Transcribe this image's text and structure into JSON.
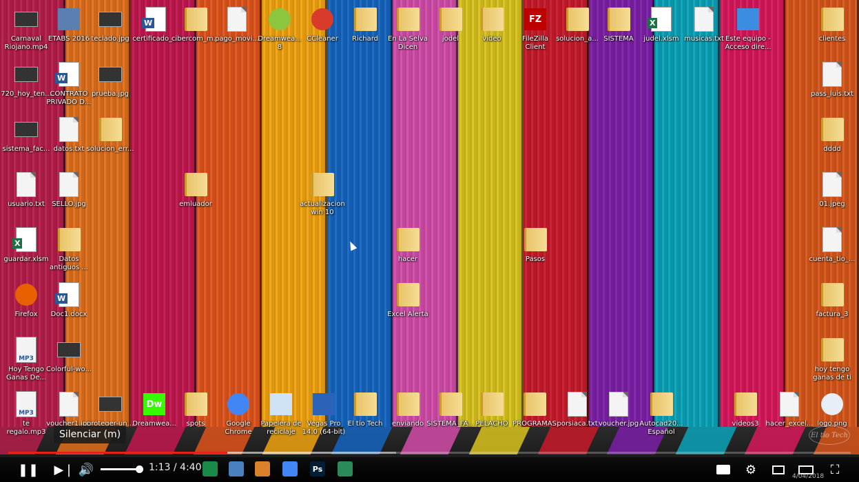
{
  "desktop": {
    "icons": [
      {
        "label": "Carnaval\nRiojano.mp4",
        "icon": "video-file-icon",
        "kind": "img"
      },
      {
        "label": "ETABS 2016",
        "icon": "etabs-app-icon",
        "kind": "app",
        "color": "#5b7fb0"
      },
      {
        "label": "teclado.jpg",
        "icon": "image-file-icon",
        "kind": "img"
      },
      {
        "label": "certificado_...",
        "icon": "word-document-icon",
        "kind": "word"
      },
      {
        "label": "cibercom_m...",
        "icon": "folder-icon",
        "kind": "folder"
      },
      {
        "label": "pago_movi...",
        "icon": "text-file-icon",
        "kind": "doc"
      },
      {
        "label": "Dreamwea...\n8",
        "icon": "dreamweaver8-icon",
        "kind": "round",
        "color": "#8cc63f"
      },
      {
        "label": "CCleaner",
        "icon": "ccleaner-icon",
        "kind": "round",
        "color": "#d93b2b"
      },
      {
        "label": "Richard",
        "icon": "folder-icon",
        "kind": "folder"
      },
      {
        "label": "En La Selva\nDicen",
        "icon": "folder-icon",
        "kind": "folder"
      },
      {
        "label": "jodel",
        "icon": "folder-icon",
        "kind": "folder"
      },
      {
        "label": "video",
        "icon": "folder-icon",
        "kind": "folder"
      },
      {
        "label": "FileZilla\nClient",
        "icon": "filezilla-icon",
        "kind": "app",
        "color": "#bf0000",
        "text": "FZ"
      },
      {
        "label": "solucion_a...",
        "icon": "folder-icon",
        "kind": "folder"
      },
      {
        "label": "SISTEMA",
        "icon": "folder-icon",
        "kind": "folder"
      },
      {
        "label": "judel.xlsm",
        "icon": "excel-file-icon",
        "kind": "excel"
      },
      {
        "label": "musicas.txt",
        "icon": "text-file-icon",
        "kind": "doc"
      },
      {
        "label": "Este equipo -\nAcceso dire...",
        "icon": "computer-icon",
        "kind": "app",
        "color": "#3a8de0"
      },
      {
        "label": "clientes",
        "icon": "folder-icon",
        "kind": "folder"
      },
      {
        "label": "720_hoy_ten...",
        "icon": "video-file-icon",
        "kind": "img"
      },
      {
        "label": "CONTRATO\nPRIVADO D...",
        "icon": "word-document-icon",
        "kind": "word"
      },
      {
        "label": "prueba.jpg",
        "icon": "image-file-icon",
        "kind": "img"
      },
      {
        "label": "pass_luis.txt",
        "icon": "text-file-icon",
        "kind": "doc"
      },
      {
        "label": "sistema_fac...",
        "icon": "image-file-icon",
        "kind": "img"
      },
      {
        "label": "datos.txt",
        "icon": "text-file-icon",
        "kind": "doc"
      },
      {
        "label": "solucion_err...",
        "icon": "folder-icon",
        "kind": "folder"
      },
      {
        "label": "dddd",
        "icon": "folder-icon",
        "kind": "folder"
      },
      {
        "label": "usuario.txt",
        "icon": "text-file-icon",
        "kind": "doc"
      },
      {
        "label": "SELLO.jpg",
        "icon": "image-file-icon",
        "kind": "doc"
      },
      {
        "label": "emluador",
        "icon": "folder-icon",
        "kind": "folder"
      },
      {
        "label": "actualizacion\nwin 10",
        "icon": "folder-icon",
        "kind": "folder"
      },
      {
        "label": "01.jpeg",
        "icon": "image-file-icon",
        "kind": "doc"
      },
      {
        "label": "guardar.xlsm",
        "icon": "excel-file-icon",
        "kind": "excel"
      },
      {
        "label": "Datos\nantiguos ...",
        "icon": "folder-icon",
        "kind": "folder"
      },
      {
        "label": "hacer",
        "icon": "folder-icon",
        "kind": "folder"
      },
      {
        "label": "Pasos",
        "icon": "folder-icon",
        "kind": "folder"
      },
      {
        "label": "cuenta_tio_...",
        "icon": "text-file-icon",
        "kind": "doc"
      },
      {
        "label": "Firefox",
        "icon": "firefox-icon",
        "kind": "round",
        "color": "#e66000"
      },
      {
        "label": "Doc1.docx",
        "icon": "word-document-icon",
        "kind": "word"
      },
      {
        "label": "Excel Alerta",
        "icon": "folder-icon",
        "kind": "folder"
      },
      {
        "label": "factura_3",
        "icon": "video-file-icon",
        "kind": "folder"
      },
      {
        "label": "Hoy Tengo\nGanas De...",
        "icon": "mp3-file-icon",
        "kind": "mp3"
      },
      {
        "label": "Colorful-wo...",
        "icon": "image-file-icon",
        "kind": "img"
      },
      {
        "label": "hoy tengo\nganas de ti",
        "icon": "folder-icon",
        "kind": "folder"
      },
      {
        "label": "te\nregalo.mp3",
        "icon": "mp3-file-icon",
        "kind": "mp3"
      },
      {
        "label": "voucher1.jpg",
        "icon": "image-file-icon",
        "kind": "doc"
      },
      {
        "label": "proteger-un...",
        "icon": "image-file-icon",
        "kind": "img"
      },
      {
        "label": "Dreamwea...",
        "icon": "dreamweaver-icon",
        "kind": "app",
        "color": "#35fa00",
        "text": "Dw"
      },
      {
        "label": "spots",
        "icon": "folder-icon",
        "kind": "folder"
      },
      {
        "label": "Google\nChrome",
        "icon": "chrome-icon",
        "kind": "round",
        "color": "#4285f4"
      },
      {
        "label": "Papelera de\nreciclaje",
        "icon": "recycle-bin-icon",
        "kind": "app",
        "color": "#cfe3f5"
      },
      {
        "label": "Vegas Pro\n14.0 (64-bit)",
        "icon": "vegas-pro-icon",
        "kind": "app",
        "color": "#2a63b8"
      },
      {
        "label": "El tio Tech",
        "icon": "folder-icon",
        "kind": "folder"
      },
      {
        "label": "enviando",
        "icon": "folder-icon",
        "kind": "folder"
      },
      {
        "label": "SISTEMA_FA...",
        "icon": "folder-icon",
        "kind": "folder"
      },
      {
        "label": "PELACHO",
        "icon": "folder-icon",
        "kind": "folder"
      },
      {
        "label": "PROGRAMAS",
        "icon": "folder-icon",
        "kind": "folder"
      },
      {
        "label": "porsiaca.txt",
        "icon": "text-file-icon",
        "kind": "doc"
      },
      {
        "label": "voucher.jpg",
        "icon": "image-file-icon",
        "kind": "doc"
      },
      {
        "label": "Autocad20...\nEspañol",
        "icon": "folder-icon",
        "kind": "folder"
      },
      {
        "label": "videos3",
        "icon": "folder-icon",
        "kind": "folder"
      },
      {
        "label": "hacer_excel...",
        "icon": "text-file-icon",
        "kind": "doc"
      },
      {
        "label": "logo.png",
        "icon": "logo-image-icon",
        "kind": "round",
        "color": "#e8eef6"
      }
    ]
  },
  "tooltip": "Silenciar (m)",
  "watermark": "El tío Tech",
  "player": {
    "played_fraction": 0.26,
    "buffered_fraction": 0.46,
    "volume_fraction": 1.0,
    "time": "1:13 / 4:40",
    "accent": "#e62117",
    "play_pause_icon": "pause-icon",
    "next_icon": "next-icon",
    "volume_icon": "volume-icon",
    "subtitles_icon": "subtitles-icon",
    "settings_icon": "settings-gear-icon",
    "miniplayer_icon": "miniplayer-icon",
    "theater_icon": "theater-mode-icon",
    "fullscreen_icon": "fullscreen-icon"
  },
  "taskbar": {
    "apps": [
      {
        "name": "windows-start-icon",
        "color": "#ffffff"
      },
      {
        "name": "search-icon",
        "color": "#ffffff"
      },
      {
        "name": "task-view-icon",
        "color": "#ffffff"
      },
      {
        "name": "camtasia-icon",
        "color": "#1a8a4a"
      },
      {
        "name": "notepad-icon",
        "color": "#4a7fc0"
      },
      {
        "name": "paint-icon",
        "color": "#d9822b"
      },
      {
        "name": "chrome-icon",
        "color": "#4285f4"
      },
      {
        "name": "photoshop-icon",
        "color": "#001e36",
        "text": "Ps"
      },
      {
        "name": "camtasia-recorder-icon",
        "color": "#2b8a5a"
      }
    ],
    "date": "4/04/2018"
  },
  "colors": {
    "planks": [
      "#b51d4a",
      "#e0701c",
      "#c2174e",
      "#e0541b",
      "#f0a30f",
      "#1565c0",
      "#d24ca9",
      "#d8c31c",
      "#c81a2a",
      "#7d1fa8",
      "#0aa3b8",
      "#d8175a",
      "#d8561a"
    ]
  }
}
